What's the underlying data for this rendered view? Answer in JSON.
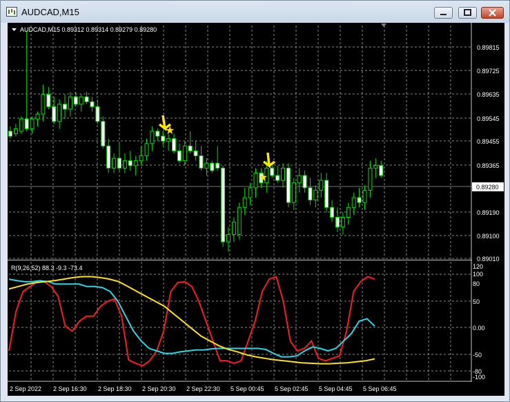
{
  "window": {
    "title": "AUDCAD,M15"
  },
  "main_chart": {
    "header": "AUDCAD,M15  0.89312 0.89314 0.89279 0.89280",
    "price_ticks": [
      "0.89815",
      "0.89725",
      "0.89635",
      "0.89545",
      "0.89455",
      "0.89365",
      "0.89190",
      "0.89100",
      "0.89010"
    ],
    "current_price": "0.89280"
  },
  "indicator": {
    "header": "R(9,26,52) 88.3 -9.3 -73.4",
    "ticks": [
      "120",
      "100",
      "80",
      "50",
      "0.00",
      "-50",
      "-80",
      "-100"
    ]
  },
  "time_axis": {
    "labels": [
      "2 Sep 2022",
      "2 Sep 16:30",
      "2 Sep 18:30",
      "2 Sep 20:30",
      "2 Sep 22:30",
      "5 Sep 00:45",
      "5 Sep 02:45",
      "5 Sep 04:45",
      "5 Sep 06:45"
    ]
  },
  "chart_data": [
    {
      "type": "candlestick",
      "ylim": [
        0.8895,
        0.899
      ],
      "candles": [
        [
          0.8947,
          0.8949,
          0.8944,
          0.8945
        ],
        [
          0.8946,
          0.895,
          0.8945,
          0.8948
        ],
        [
          0.8947,
          0.8953,
          0.8946,
          0.8952
        ],
        [
          0.8952,
          0.8988,
          0.8947,
          0.8948
        ],
        [
          0.8948,
          0.8953,
          0.8946,
          0.8952
        ],
        [
          0.8952,
          0.8955,
          0.8949,
          0.8954
        ],
        [
          0.8954,
          0.8966,
          0.8951,
          0.8962
        ],
        [
          0.8962,
          0.8965,
          0.8956,
          0.8957
        ],
        [
          0.8957,
          0.8961,
          0.895,
          0.8951
        ],
        [
          0.8951,
          0.896,
          0.8948,
          0.8958
        ],
        [
          0.8958,
          0.8962,
          0.8952,
          0.8956
        ],
        [
          0.8956,
          0.8963,
          0.8953,
          0.8961
        ],
        [
          0.8961,
          0.8963,
          0.8957,
          0.8958
        ],
        [
          0.8958,
          0.8962,
          0.8955,
          0.8961
        ],
        [
          0.8961,
          0.8963,
          0.8958,
          0.8959
        ],
        [
          0.8959,
          0.8961,
          0.8955,
          0.8957
        ],
        [
          0.8957,
          0.896,
          0.895,
          0.8951
        ],
        [
          0.8951,
          0.8953,
          0.894,
          0.8941
        ],
        [
          0.8941,
          0.8944,
          0.893,
          0.8932
        ],
        [
          0.8932,
          0.8938,
          0.893,
          0.8936
        ],
        [
          0.8936,
          0.8942,
          0.8931,
          0.8932
        ],
        [
          0.8932,
          0.8938,
          0.893,
          0.8935
        ],
        [
          0.8935,
          0.8939,
          0.8931,
          0.8933
        ],
        [
          0.8933,
          0.8937,
          0.8929,
          0.8935
        ],
        [
          0.8935,
          0.8941,
          0.8933,
          0.8937
        ],
        [
          0.8937,
          0.8944,
          0.8935,
          0.8942
        ],
        [
          0.8942,
          0.8949,
          0.8939,
          0.8947
        ],
        [
          0.8947,
          0.8948,
          0.8943,
          0.8945
        ],
        [
          0.8945,
          0.8947,
          0.8941,
          0.8943
        ],
        [
          0.8943,
          0.8946,
          0.8939,
          0.8944
        ],
        [
          0.8944,
          0.8946,
          0.8938,
          0.8939
        ],
        [
          0.8939,
          0.8942,
          0.8934,
          0.8935
        ],
        [
          0.8935,
          0.8943,
          0.8933,
          0.8941
        ],
        [
          0.8941,
          0.8947,
          0.8938,
          0.8939
        ],
        [
          0.8939,
          0.8943,
          0.8935,
          0.8937
        ],
        [
          0.8937,
          0.8941,
          0.8931,
          0.8932
        ],
        [
          0.8932,
          0.8936,
          0.8929,
          0.8934
        ],
        [
          0.8934,
          0.8935,
          0.893,
          0.8931
        ],
        [
          0.8934,
          0.8941,
          0.8931,
          0.8932
        ],
        [
          0.8932,
          0.8933,
          0.89,
          0.8902
        ],
        [
          0.8902,
          0.8908,
          0.8898,
          0.8905
        ],
        [
          0.8905,
          0.8912,
          0.8902,
          0.891
        ],
        [
          0.8905,
          0.8918,
          0.8903,
          0.8916
        ],
        [
          0.8916,
          0.8924,
          0.8913,
          0.892
        ],
        [
          0.892,
          0.8926,
          0.8917,
          0.8924
        ],
        [
          0.8924,
          0.8932,
          0.892,
          0.893
        ],
        [
          0.893,
          0.8932,
          0.8924,
          0.8926
        ],
        [
          0.8926,
          0.8935,
          0.8922,
          0.8932
        ],
        [
          0.8932,
          0.8934,
          0.8928,
          0.8929
        ],
        [
          0.8929,
          0.8933,
          0.8926,
          0.8927
        ],
        [
          0.8927,
          0.8934,
          0.8924,
          0.8932
        ],
        [
          0.8932,
          0.8934,
          0.8916,
          0.8918
        ],
        [
          0.8918,
          0.8928,
          0.8915,
          0.8926
        ],
        [
          0.8926,
          0.8932,
          0.8922,
          0.8929
        ],
        [
          0.8929,
          0.8931,
          0.8922,
          0.8924
        ],
        [
          0.8924,
          0.8928,
          0.8917,
          0.8919
        ],
        [
          0.8919,
          0.8925,
          0.8916,
          0.8923
        ],
        [
          0.8923,
          0.893,
          0.892,
          0.8927
        ],
        [
          0.8927,
          0.893,
          0.8914,
          0.8916
        ],
        [
          0.8916,
          0.8919,
          0.891,
          0.8912
        ],
        [
          0.8912,
          0.8916,
          0.8906,
          0.8908
        ],
        [
          0.8908,
          0.8914,
          0.8905,
          0.8912
        ],
        [
          0.8912,
          0.8918,
          0.8909,
          0.8916
        ],
        [
          0.8916,
          0.8922,
          0.8913,
          0.892
        ],
        [
          0.892,
          0.8924,
          0.8916,
          0.8918
        ],
        [
          0.8918,
          0.8925,
          0.8915,
          0.8923
        ],
        [
          0.8923,
          0.8935,
          0.892,
          0.8932
        ],
        [
          0.8932,
          0.8936,
          0.8928,
          0.8933
        ],
        [
          0.8933,
          0.8935,
          0.8928,
          0.8929
        ]
      ]
    },
    {
      "type": "line",
      "ylim": [
        -120,
        120
      ],
      "series": [
        {
          "color": "#ff1a1a",
          "values": [
            -60,
            20,
            60,
            70,
            80,
            80,
            70,
            50,
            -10,
            -20,
            0,
            10,
            10,
            30,
            40,
            45,
            10,
            -78,
            -85,
            -90,
            -80,
            -60,
            -20,
            60,
            78,
            80,
            70,
            40,
            0,
            -40,
            -80,
            -80,
            -85,
            -80,
            -40,
            0,
            60,
            85,
            90,
            40,
            -40,
            -60,
            -55,
            -40,
            -75,
            -80,
            -75,
            -70,
            -20,
            60,
            80,
            90,
            85
          ]
        },
        {
          "color": "#2ad7e8",
          "values": [
            85,
            82,
            80,
            80,
            82,
            80,
            75,
            75,
            75,
            75,
            70,
            70,
            68,
            60,
            40,
            10,
            -20,
            -40,
            -55,
            -60,
            -65,
            -65,
            -62,
            -60,
            -58,
            -58,
            -56,
            -55,
            -55,
            -55,
            -55,
            -55,
            -55,
            -57,
            -65,
            -72,
            -72,
            -70,
            -60,
            -52,
            -55,
            -60,
            -55,
            -40,
            -25,
            0,
            5,
            -10
          ]
        },
        {
          "color": "#ffe01a",
          "values": [
            65,
            70,
            75,
            78,
            80,
            82,
            85,
            88,
            90,
            90,
            88,
            85,
            80,
            70,
            60,
            50,
            40,
            30,
            15,
            0,
            -15,
            -30,
            -40,
            -50,
            -57,
            -62,
            -68,
            -72,
            -75,
            -78,
            -80,
            -82,
            -84,
            -85,
            -86,
            -86,
            -85,
            -84,
            -82,
            -80,
            -76
          ]
        }
      ]
    }
  ]
}
